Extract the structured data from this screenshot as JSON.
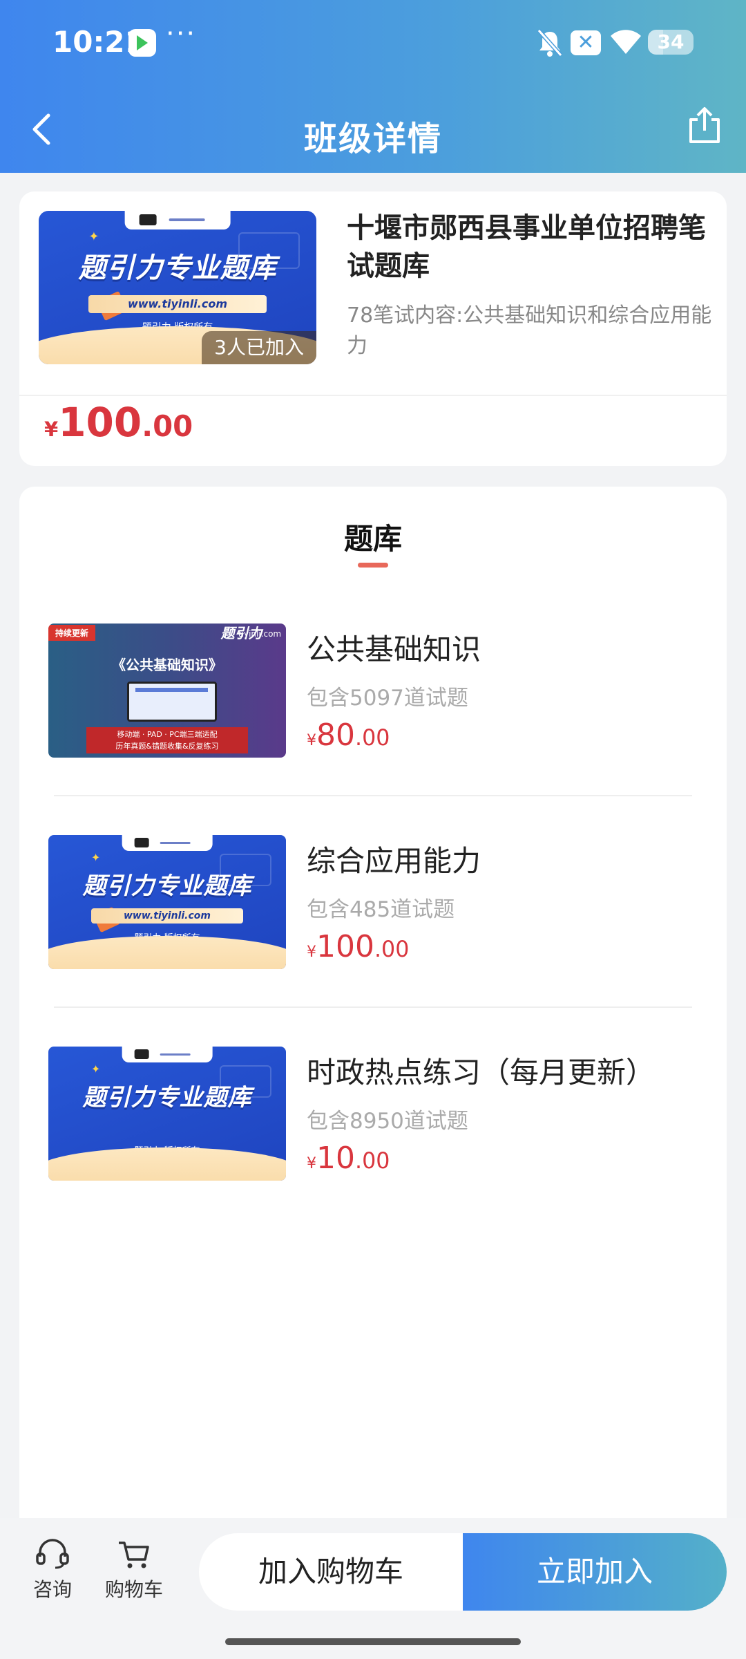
{
  "status_bar": {
    "time": "10:21",
    "more": "···",
    "battery": "34",
    "battery_level": 0.34
  },
  "nav": {
    "title": "班级详情"
  },
  "product": {
    "title": "十堰市郧西县事业单位招聘笔试题库",
    "description": "78笔试内容:公共基础知识和综合应用能力",
    "joined": "3人已加入",
    "price": {
      "symbol": "¥",
      "int": "100",
      "dec": ".00"
    },
    "cover": {
      "headline": "题引力专业题库",
      "url": "www.tiyinli.com",
      "copyright": "题引力 版权所有"
    }
  },
  "bank": {
    "title": "题库",
    "items": [
      {
        "name": "公共基础知识",
        "count": "包含5097道试题",
        "price": {
          "symbol": "¥",
          "int": "80",
          "dec": ".00"
        },
        "cover": {
          "ribbon": "持续更新",
          "logo": "题引力",
          "site": "tiyinli.com",
          "headline": "《公共基础知识》",
          "bar_line1": "移动端 · PAD · PC端三端适配",
          "bar_line2": "历年真题&错题收集&反复练习"
        }
      },
      {
        "name": "综合应用能力",
        "count": "包含485道试题",
        "price": {
          "symbol": "¥",
          "int": "100",
          "dec": ".00"
        },
        "cover": {
          "headline": "题引力专业题库",
          "url": "www.tiyinli.com",
          "copyright": "题引力 版权所有"
        }
      },
      {
        "name": "时政热点练习（每月更新）",
        "count": "包含8950道试题",
        "price": {
          "symbol": "¥",
          "int": "10",
          "dec": ".00"
        },
        "cover": {
          "headline": "题引力专业题库",
          "copyright": "题引力 版权所有"
        }
      }
    ]
  },
  "bottom_bar": {
    "consult": "咨询",
    "cart": "购物车",
    "add_to_cart": "加入购物车",
    "join_now": "立即加入"
  }
}
